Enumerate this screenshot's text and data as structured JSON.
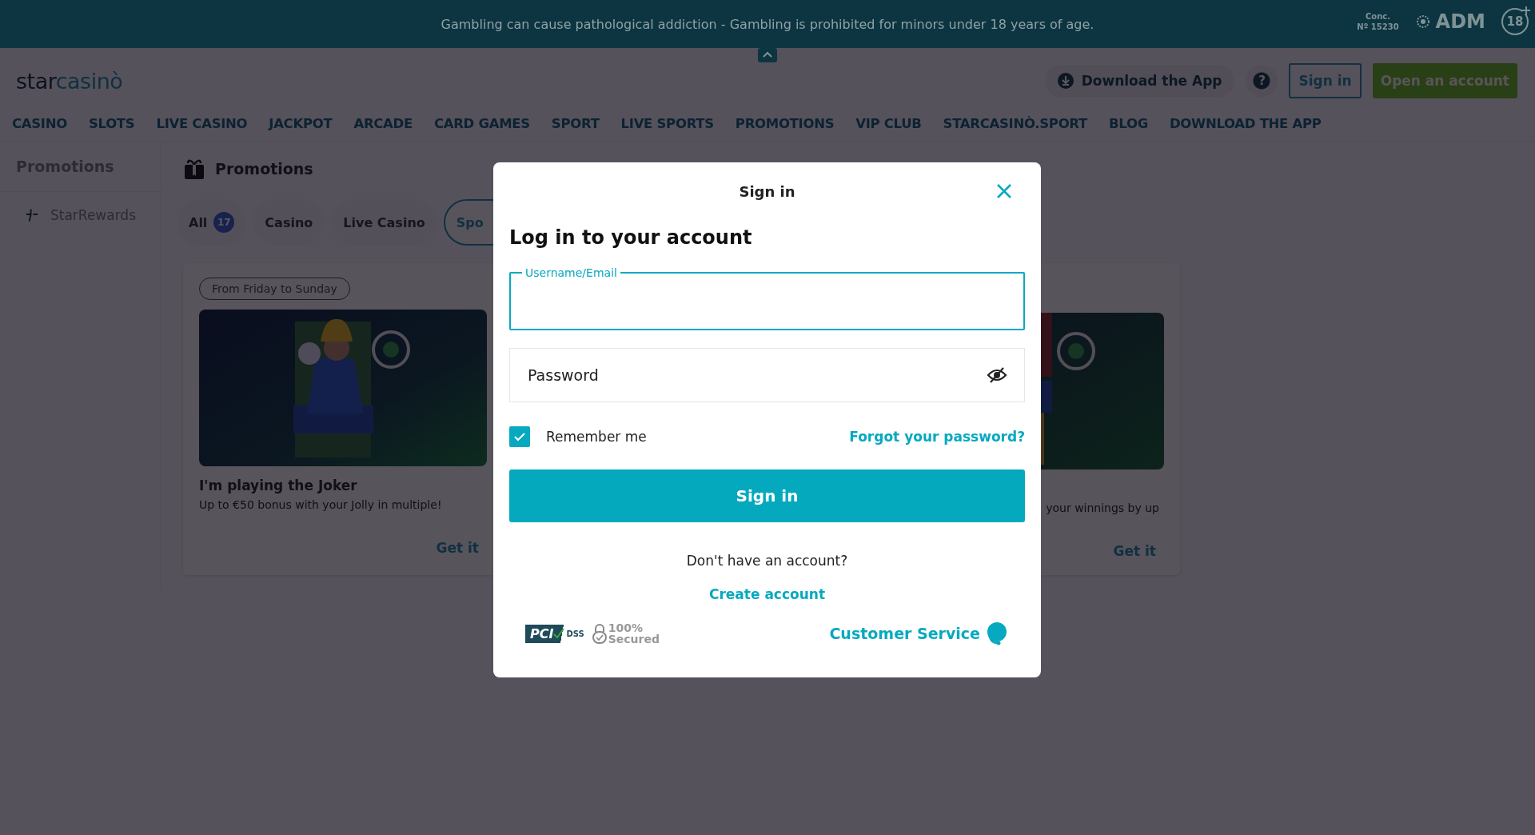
{
  "warning_banner": {
    "text": "Gambling can cause pathological addiction - Gambling is prohibited for minors under 18 years of age.",
    "licence": [
      "Conc.",
      "Nº 15230"
    ],
    "regulator": "ADM",
    "age_limit": "18"
  },
  "header": {
    "logo": [
      "star",
      "casinò"
    ],
    "download_app": "Download the App",
    "help": "?",
    "sign_in": "Sign in",
    "open_account": "Open an account"
  },
  "nav": [
    "CASINO",
    "SLOTS",
    "LIVE CASINO",
    "JACKPOT",
    "ARCADE",
    "CARD GAMES",
    "SPORT",
    "LIVE SPORTS",
    "PROMOTIONS",
    "VIP CLUB",
    "STARCASINÒ.SPORT",
    "BLOG",
    "DOWNLOAD THE APP"
  ],
  "sidebar": {
    "title": "Promotions",
    "items": [
      {
        "label": "StarRewards"
      }
    ]
  },
  "content": {
    "title": "Promotions",
    "filters": [
      {
        "label": "All",
        "count": "17",
        "selected": false
      },
      {
        "label": "Casino",
        "selected": false
      },
      {
        "label": "Live Casino",
        "selected": false
      },
      {
        "label": "Spo",
        "selected": true
      }
    ],
    "cards": [
      {
        "kind": "full",
        "tag": "From Friday to Sunday",
        "title": "I'm playing the Joker",
        "description": "Up to €50 bonus with your Jolly in multiple!",
        "action": "Get it"
      },
      {
        "kind": "hidden"
      },
      {
        "kind": "partial",
        "description": "your winnings by up",
        "action": "Get it"
      }
    ]
  },
  "modal": {
    "title": "Sign in",
    "heading": "Log in to your account",
    "username_field": {
      "label": "Username/Email",
      "focused": true
    },
    "password_field": {
      "placeholder": "Password"
    },
    "remember_me": {
      "label": "Remember me",
      "checked": true
    },
    "forgot_password": "Forgot your password?",
    "submit": "Sign in",
    "no_account": "Don't have an account?",
    "create_account": "Create account",
    "pci_badge": [
      "PCI",
      "DSS"
    ],
    "secured_badge": [
      "100%",
      "Secured"
    ],
    "customer_service": "Customer Service"
  }
}
